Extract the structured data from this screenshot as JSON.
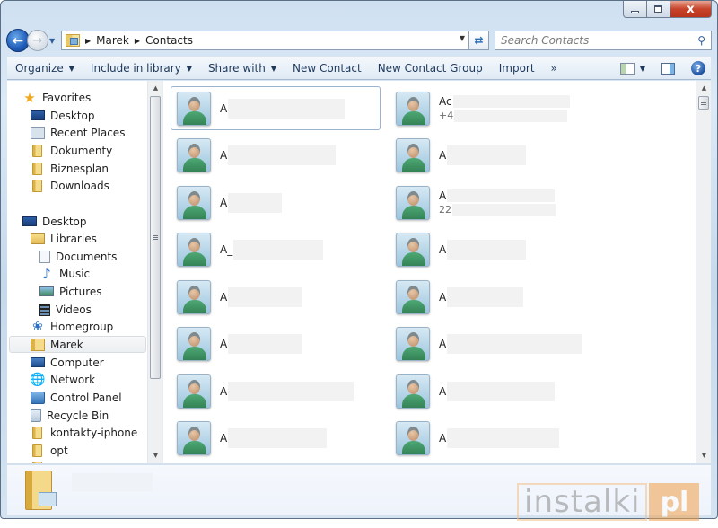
{
  "window": {
    "controls": {
      "minimize": "minimize",
      "maximize": "maximize",
      "close": "x"
    }
  },
  "navigation": {
    "back_icon": "back-arrow-icon",
    "forward_icon": "forward-arrow-icon",
    "breadcrumb": [
      "Marek",
      "Contacts"
    ],
    "refresh_icon": "refresh-icon",
    "search_placeholder": "Search Contacts"
  },
  "toolbar": {
    "buttons": [
      {
        "label": "Organize",
        "has_dropdown": true
      },
      {
        "label": "Include in library",
        "has_dropdown": true
      },
      {
        "label": "Share with",
        "has_dropdown": true
      },
      {
        "label": "New Contact",
        "has_dropdown": false
      },
      {
        "label": "New Contact Group",
        "has_dropdown": false
      },
      {
        "label": "Import",
        "has_dropdown": false
      },
      {
        "label": "»",
        "has_dropdown": false
      }
    ],
    "views_icon": "change-view-icon",
    "preview_icon": "preview-pane-icon",
    "help_icon": "?"
  },
  "sidebar": {
    "items": [
      {
        "label": "Favorites",
        "icon": "star-icon",
        "level": 0
      },
      {
        "label": "Desktop",
        "icon": "desktop-icon",
        "level": 1
      },
      {
        "label": "Recent Places",
        "icon": "recent-places-icon",
        "level": 1
      },
      {
        "label": "Dokumenty",
        "icon": "folder-icon",
        "level": 1
      },
      {
        "label": "Biznesplan",
        "icon": "folder-icon",
        "level": 1
      },
      {
        "label": "Downloads",
        "icon": "downloads-folder-icon",
        "level": 1
      },
      {
        "label": "Desktop",
        "icon": "desktop-icon",
        "level": 0
      },
      {
        "label": "Libraries",
        "icon": "libraries-icon",
        "level": 1
      },
      {
        "label": "Documents",
        "icon": "documents-icon",
        "level": 2
      },
      {
        "label": "Music",
        "icon": "music-icon",
        "level": 2
      },
      {
        "label": "Pictures",
        "icon": "pictures-icon",
        "level": 2
      },
      {
        "label": "Videos",
        "icon": "videos-icon",
        "level": 2
      },
      {
        "label": "Homegroup",
        "icon": "homegroup-icon",
        "level": 1
      },
      {
        "label": "Marek",
        "icon": "user-folder-icon",
        "level": 1,
        "selected": true
      },
      {
        "label": "Computer",
        "icon": "computer-icon",
        "level": 1
      },
      {
        "label": "Network",
        "icon": "network-icon",
        "level": 1
      },
      {
        "label": "Control Panel",
        "icon": "control-panel-icon",
        "level": 1
      },
      {
        "label": "Recycle Bin",
        "icon": "recycle-bin-icon",
        "level": 1
      },
      {
        "label": "kontakty-iphone",
        "icon": "folder-icon",
        "level": 1
      },
      {
        "label": "opt",
        "icon": "folder-icon",
        "level": 1
      }
    ]
  },
  "contacts": [
    {
      "name_visible": "A",
      "sub_visible": "",
      "selected": true
    },
    {
      "name_visible": "Ac",
      "sub_visible": "+4"
    },
    {
      "name_visible": "A",
      "sub_visible": ""
    },
    {
      "name_visible": "A",
      "sub_visible": ""
    },
    {
      "name_visible": "A",
      "sub_visible": ""
    },
    {
      "name_visible": "A",
      "sub_visible": "22"
    },
    {
      "name_visible": "A_",
      "sub_visible": ""
    },
    {
      "name_visible": "A",
      "sub_visible": ""
    },
    {
      "name_visible": "A",
      "sub_visible": ""
    },
    {
      "name_visible": "A",
      "sub_visible": ""
    },
    {
      "name_visible": "A",
      "sub_visible": ""
    },
    {
      "name_visible": "A",
      "sub_visible": ""
    },
    {
      "name_visible": "A",
      "sub_visible": ""
    },
    {
      "name_visible": "A",
      "sub_visible": ""
    },
    {
      "name_visible": "A",
      "sub_visible": ""
    },
    {
      "name_visible": "A",
      "sub_visible": ""
    }
  ],
  "details_pane": {
    "icon": "contacts-folder-icon",
    "name": ""
  },
  "watermark": {
    "text": "instalki",
    "logo": "pl"
  }
}
